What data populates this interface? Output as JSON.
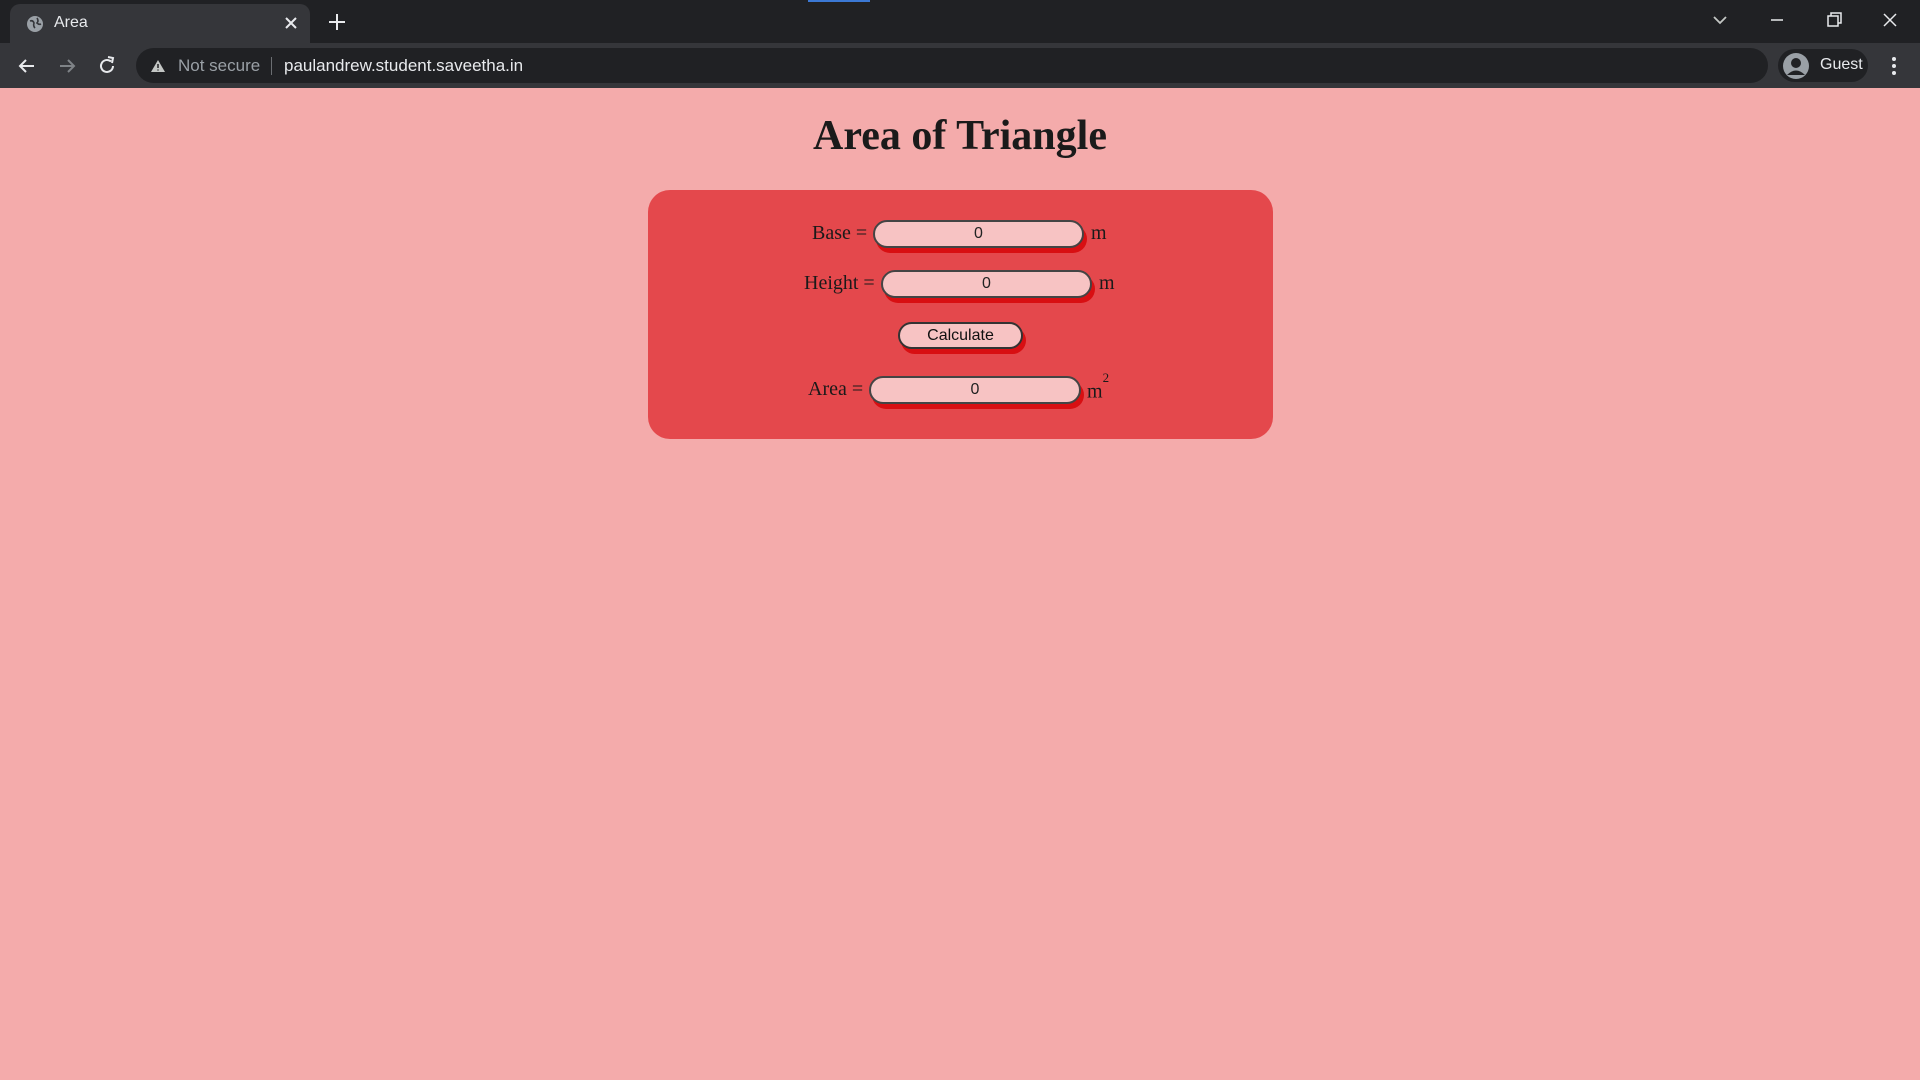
{
  "browser": {
    "tab_title": "Area",
    "security_label": "Not secure",
    "url": "paulandrew.student.saveetha.in",
    "profile_label": "Guest"
  },
  "page": {
    "title": "Area of Triangle",
    "base": {
      "label": "Base =",
      "value": "0",
      "unit": "m"
    },
    "height": {
      "label": "Height =",
      "value": "0",
      "unit": "m"
    },
    "calculate_label": "Calculate",
    "area": {
      "label": "Area =",
      "value": "0",
      "unit": "m",
      "unit_exponent": "2"
    }
  },
  "colors": {
    "page_background": "#f4abab",
    "card_background": "#e4484c",
    "field_background": "#f7c3c3",
    "field_shadow": "#d80f12"
  }
}
